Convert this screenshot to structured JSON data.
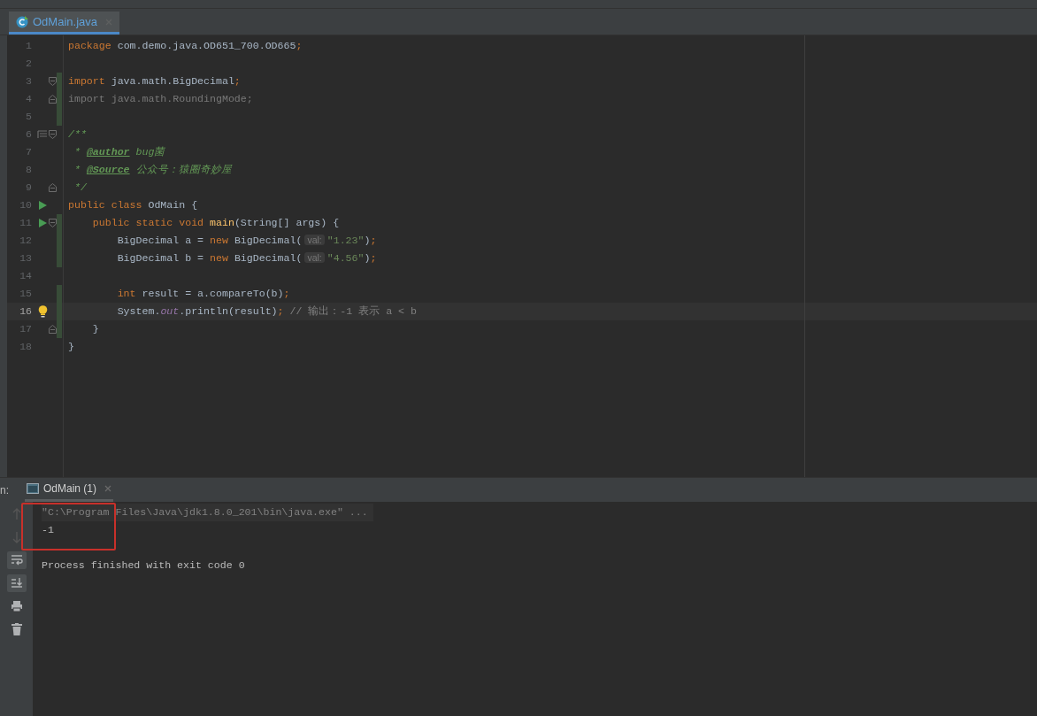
{
  "editor_tabs": [
    {
      "label": "OdMain.java",
      "selected": true
    }
  ],
  "code_lines": [
    {
      "number": "1",
      "current": false,
      "changed": false,
      "tokens": [
        {
          "kind": "keyword",
          "text": "package "
        },
        {
          "kind": "plain",
          "text": "com.demo.java.OD651_700.OD665"
        },
        {
          "kind": "keyword",
          "text": ";"
        }
      ]
    },
    {
      "number": "2",
      "current": false,
      "changed": false
    },
    {
      "number": "3",
      "current": false,
      "changed": true,
      "fold_start": true,
      "tokens": [
        {
          "kind": "keyword",
          "text": "import "
        },
        {
          "kind": "plain",
          "text": "java.math.BigDecimal"
        },
        {
          "kind": "keyword",
          "text": ";"
        }
      ]
    },
    {
      "number": "4",
      "current": false,
      "changed": true,
      "fold_end": true,
      "tokens": [
        {
          "kind": "unused",
          "text": "import java.math.RoundingMode;"
        }
      ]
    },
    {
      "number": "5",
      "current": false,
      "changed": true
    },
    {
      "number": "6",
      "current": false,
      "changed": false,
      "fold_start": true,
      "doc_toggle": true,
      "tokens": [
        {
          "kind": "doc",
          "text": "/**"
        }
      ]
    },
    {
      "number": "7",
      "current": false,
      "changed": false,
      "tokens": [
        {
          "kind": "doc",
          "text": " * "
        },
        {
          "kind": "doctag",
          "text": "@author"
        },
        {
          "kind": "doc",
          "text": " bug菌"
        }
      ]
    },
    {
      "number": "8",
      "current": false,
      "changed": false,
      "tokens": [
        {
          "kind": "doc",
          "text": " * "
        },
        {
          "kind": "doctag",
          "text": "@Source"
        },
        {
          "kind": "doc",
          "text": " 公众号：猿圈奇妙屋"
        }
      ]
    },
    {
      "number": "9",
      "current": false,
      "changed": false,
      "fold_end": true,
      "tokens": [
        {
          "kind": "doc",
          "text": " */"
        }
      ]
    },
    {
      "number": "10",
      "current": false,
      "changed": false,
      "runnable": true,
      "tokens": [
        {
          "kind": "keyword",
          "text": "public class "
        },
        {
          "kind": "plain",
          "text": "OdMain {"
        }
      ]
    },
    {
      "number": "11",
      "current": false,
      "changed": true,
      "runnable": true,
      "fold_start": true,
      "tokens": [
        {
          "kind": "keyword",
          "text": "    public static void "
        },
        {
          "kind": "method",
          "text": "main"
        },
        {
          "kind": "plain",
          "text": "(String[] args) {"
        }
      ]
    },
    {
      "number": "12",
      "current": false,
      "changed": true,
      "tokens": [
        {
          "kind": "plain",
          "text": "        BigDecimal a = "
        },
        {
          "kind": "keyword",
          "text": "new "
        },
        {
          "kind": "plain",
          "text": "BigDecimal("
        },
        {
          "kind": "hint",
          "text": "val:"
        },
        {
          "kind": "string",
          "text": "\"1.23\""
        },
        {
          "kind": "plain",
          "text": ")"
        },
        {
          "kind": "keyword",
          "text": ";"
        }
      ]
    },
    {
      "number": "13",
      "current": false,
      "changed": true,
      "tokens": [
        {
          "kind": "plain",
          "text": "        BigDecimal b = "
        },
        {
          "kind": "keyword",
          "text": "new "
        },
        {
          "kind": "plain",
          "text": "BigDecimal("
        },
        {
          "kind": "hint",
          "text": "val:"
        },
        {
          "kind": "string",
          "text": "\"4.56\""
        },
        {
          "kind": "plain",
          "text": ")"
        },
        {
          "kind": "keyword",
          "text": ";"
        }
      ]
    },
    {
      "number": "14",
      "current": false,
      "changed": false
    },
    {
      "number": "15",
      "current": false,
      "changed": true,
      "tokens": [
        {
          "kind": "keyword",
          "text": "        int "
        },
        {
          "kind": "plain",
          "text": "result = a.compareTo(b)"
        },
        {
          "kind": "keyword",
          "text": ";"
        }
      ]
    },
    {
      "number": "16",
      "current": true,
      "changed": true,
      "intention": true,
      "tokens": [
        {
          "kind": "plain",
          "text": "        System."
        },
        {
          "kind": "field",
          "text": "out"
        },
        {
          "kind": "plain",
          "text": ".println(result)"
        },
        {
          "kind": "keyword",
          "text": "; "
        },
        {
          "kind": "comment",
          "text": "// 输出：-1 表示 a < b"
        }
      ]
    },
    {
      "number": "17",
      "current": false,
      "changed": true,
      "fold_end": true,
      "tokens": [
        {
          "kind": "plain",
          "text": "    }"
        }
      ]
    },
    {
      "number": "18",
      "current": false,
      "changed": false,
      "tokens": [
        {
          "kind": "plain",
          "text": "}"
        }
      ]
    }
  ],
  "run_panel": {
    "label": "n:",
    "tabs": [
      {
        "label": "OdMain (1)",
        "selected": true
      }
    ],
    "console": [
      {
        "kind": "command",
        "text": "\"C:\\Program Files\\Java\\jdk1.8.0_201\\bin\\java.exe\" ..."
      },
      {
        "kind": "output",
        "text": "-1"
      },
      {
        "kind": "status",
        "text": "Process finished with exit code 0"
      }
    ]
  }
}
